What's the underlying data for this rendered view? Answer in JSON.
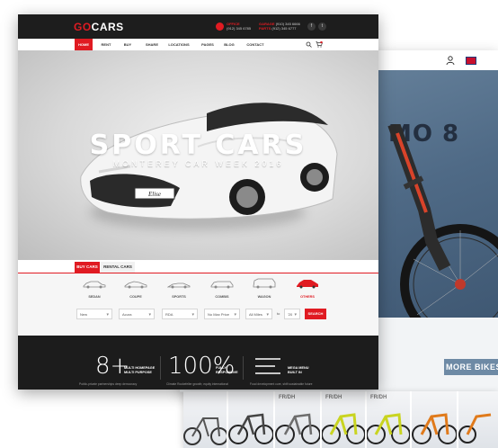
{
  "cars_site": {
    "logo": {
      "go": "GO",
      "cars": "CARS"
    },
    "contacts": [
      {
        "title": "OFFICE",
        "line1": "(912) 345 6785"
      },
      {
        "title": "GARAGE",
        "line1": "(910) 345 6666"
      },
      {
        "title": "PARTS",
        "line1": "(912) 345 6777"
      }
    ],
    "nav": [
      "HOME",
      "RENT",
      "BUY",
      "SHARE",
      "LOCATIONS",
      "PAGES",
      "BLOG",
      "CONTACT"
    ],
    "hero": {
      "title": "SPORT CARS",
      "subtitle": "MONTEREY CAR WEEK 2016",
      "plate": "Elise"
    },
    "search_tabs": [
      "BUY CARS",
      "RENTAL CARS"
    ],
    "body_types": [
      "SEDAN",
      "COUPE",
      "SPORTS",
      "COMBIS",
      "WAGON",
      "OTHERS"
    ],
    "filters": {
      "make": "New",
      "model": "Acura",
      "type": "RDA",
      "price": "No Max Price",
      "mileage": "All Miles",
      "to_label": "to",
      "year": "'20",
      "search": "SEARCH"
    },
    "stats": [
      {
        "value": "8+",
        "label1": "MULTI HOMEPAGE",
        "label2": "MULTI PURPOSE",
        "desc": "Public-private partnerships deep democracy"
      },
      {
        "value": "100%",
        "label1": "FULLY",
        "label2": "RESPONSIVE",
        "desc": "Climate Rockefeller growth; equity international"
      },
      {
        "value": "≡",
        "label1": "MEGA MENU",
        "label2": "BUILT IN",
        "desc": "Food development cure, shift sustainable future"
      }
    ],
    "colors": {
      "accent": "#e01b22",
      "dark": "#1c1c1c"
    }
  },
  "bike_site": {
    "hero_text": "MO 8",
    "more_button": "MORE BIKES",
    "strip_labels": [
      "FR/DH",
      "FR/DH",
      "FR/DH"
    ]
  }
}
